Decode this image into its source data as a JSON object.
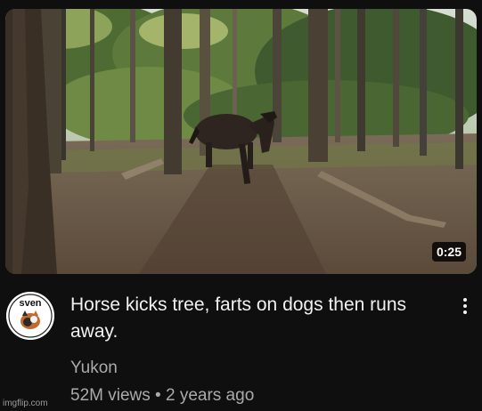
{
  "video": {
    "duration": "0:25",
    "title": "Horse kicks tree, farts on dogs then runs away.",
    "channel": "Yukon",
    "views": "52M views",
    "separator": "•",
    "age": "2 years ago"
  },
  "avatar": {
    "text": "sven"
  },
  "watermark": "imgflip.com",
  "icons": {
    "more": "more-vert-icon"
  },
  "colors": {
    "background": "#0f0f0f",
    "title": "#f1f1f1",
    "secondary_text": "#aaaaaa"
  }
}
